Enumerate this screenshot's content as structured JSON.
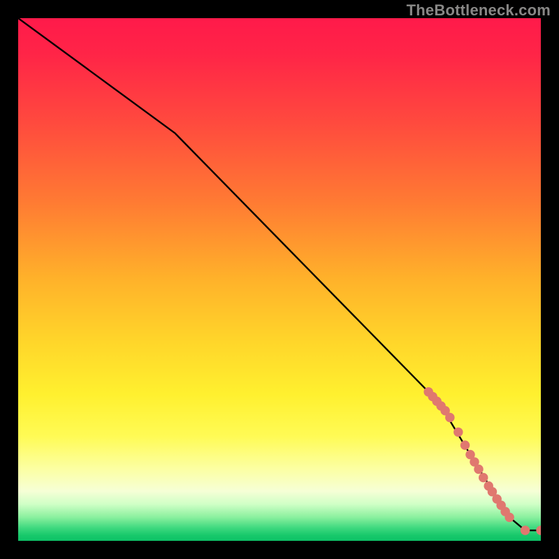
{
  "watermark": "TheBottleneck.com",
  "chart_data": {
    "type": "line",
    "xlabel": "",
    "ylabel": "",
    "xlim": [
      0,
      100
    ],
    "ylim": [
      0,
      100
    ],
    "title": "",
    "gradient_stops": [
      {
        "offset": 0.0,
        "color": "#ff1a4a"
      },
      {
        "offset": 0.07,
        "color": "#ff2547"
      },
      {
        "offset": 0.2,
        "color": "#ff4a3e"
      },
      {
        "offset": 0.35,
        "color": "#ff7a33"
      },
      {
        "offset": 0.5,
        "color": "#ffb22a"
      },
      {
        "offset": 0.62,
        "color": "#ffd62a"
      },
      {
        "offset": 0.72,
        "color": "#fff02f"
      },
      {
        "offset": 0.8,
        "color": "#fffb55"
      },
      {
        "offset": 0.86,
        "color": "#fcffa0"
      },
      {
        "offset": 0.905,
        "color": "#f6ffd6"
      },
      {
        "offset": 0.93,
        "color": "#cfffc6"
      },
      {
        "offset": 0.955,
        "color": "#8af09e"
      },
      {
        "offset": 0.975,
        "color": "#3fd97f"
      },
      {
        "offset": 0.99,
        "color": "#16c86a"
      },
      {
        "offset": 1.0,
        "color": "#0ec267"
      }
    ],
    "series": [
      {
        "name": "curve",
        "x": [
          0,
          30,
          78.5,
          82.0,
          86.5,
          90.5,
          94.0,
          97.0,
          100
        ],
        "y": [
          100,
          78,
          28.5,
          24.0,
          16.5,
          10.0,
          4.5,
          2.0,
          2.0
        ]
      }
    ],
    "markers": {
      "name": "highlight-points",
      "color": "#e0786f",
      "radius_fraction": 0.009,
      "x": [
        78.5,
        79.3,
        80.1,
        80.9,
        81.7,
        82.6,
        84.2,
        85.5,
        86.5,
        87.3,
        88.1,
        89.0,
        90.0,
        90.7,
        91.6,
        92.4,
        93.2,
        94.0,
        97.0,
        100.0
      ],
      "y": [
        28.5,
        27.6,
        26.7,
        25.8,
        24.9,
        23.6,
        20.8,
        18.3,
        16.5,
        15.1,
        13.7,
        12.1,
        10.5,
        9.4,
        8.0,
        6.8,
        5.6,
        4.5,
        2.0,
        2.0
      ]
    }
  }
}
